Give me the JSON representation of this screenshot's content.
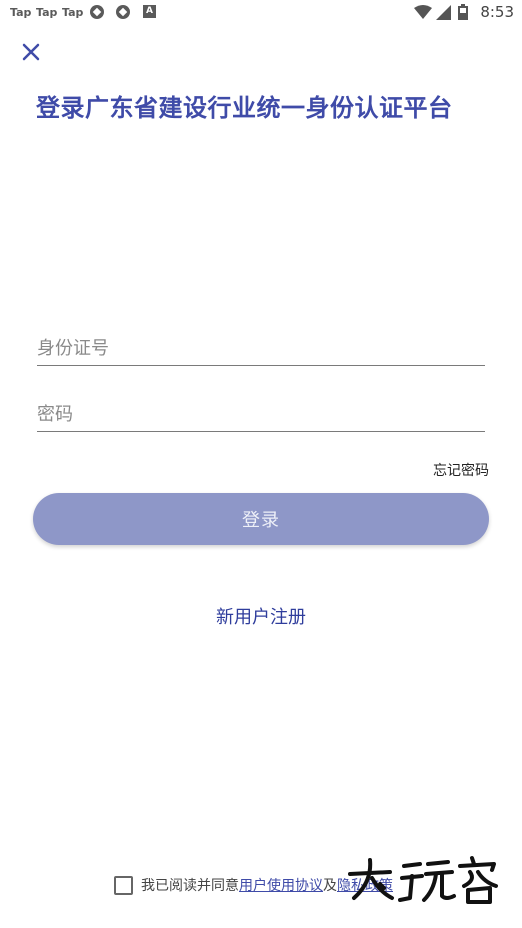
{
  "status_bar": {
    "notifications": [
      "Tap",
      "Tap",
      "Tap"
    ],
    "extra_icons": [
      "aperture-icon",
      "aperture-icon",
      "a-icon"
    ],
    "time": "8:53"
  },
  "header": {
    "close_icon": "close-icon",
    "title": "登录广东省建设行业统一身份认证平台"
  },
  "form": {
    "id_placeholder": "身份证号",
    "password_placeholder": "密码",
    "forgot_label": "忘记密码",
    "login_label": "登录",
    "register_label": "新用户注册"
  },
  "agreement": {
    "prefix": "我已阅读并同意",
    "user_agreement": "用户使用协议",
    "conjunction": "及",
    "privacy_policy": "隐私政策"
  },
  "colors": {
    "title": "#3f4ba8",
    "button": "#8e97c8",
    "link": "#2f3d9c"
  }
}
